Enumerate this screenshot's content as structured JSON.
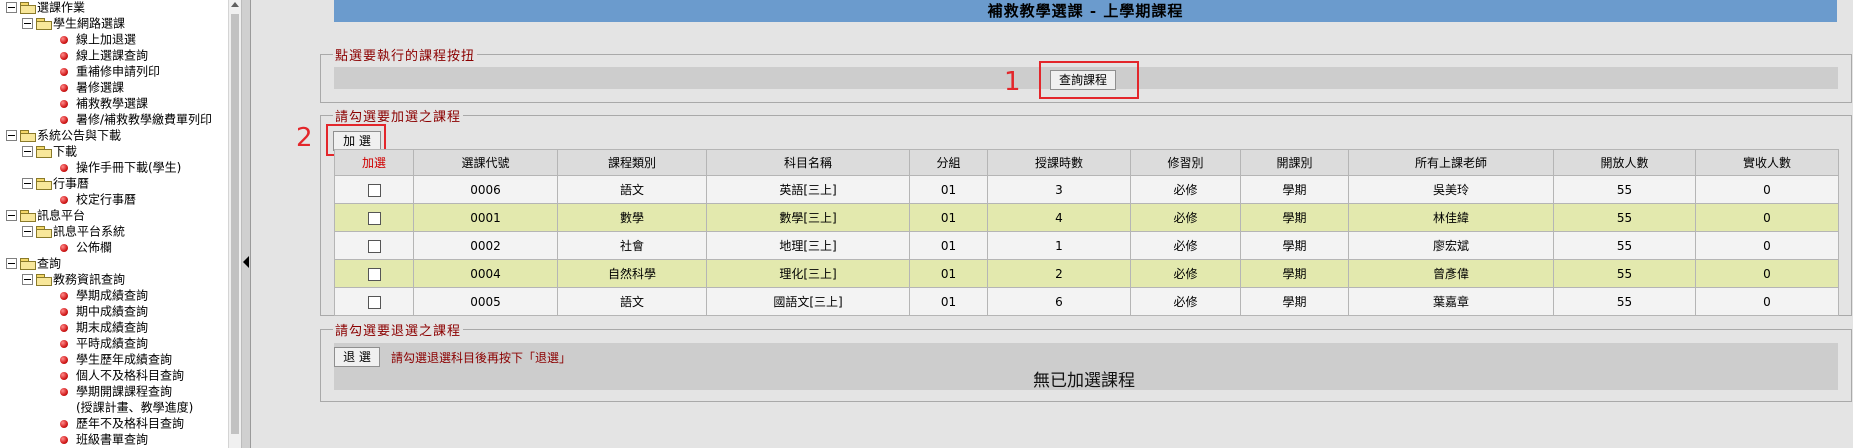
{
  "tree": {
    "items": [
      {
        "level": 0,
        "type": "folder",
        "label": "選課作業"
      },
      {
        "level": 1,
        "type": "folder",
        "label": "學生網路選課"
      },
      {
        "level": 2,
        "type": "leaf",
        "label": "線上加退選"
      },
      {
        "level": 2,
        "type": "leaf",
        "label": "線上選課查詢"
      },
      {
        "level": 2,
        "type": "leaf",
        "label": "重補修申請列印"
      },
      {
        "level": 2,
        "type": "leaf",
        "label": "暑修選課"
      },
      {
        "level": 2,
        "type": "leaf",
        "label": "補救教學選課"
      },
      {
        "level": 2,
        "type": "leaf",
        "label": "暑修/補救教學繳費單列印"
      },
      {
        "level": 0,
        "type": "folder",
        "label": "系統公告與下載"
      },
      {
        "level": 1,
        "type": "folder",
        "label": "下載"
      },
      {
        "level": 2,
        "type": "leaf",
        "label": "操作手冊下載(學生)"
      },
      {
        "level": 1,
        "type": "folder",
        "label": "行事曆"
      },
      {
        "level": 2,
        "type": "leaf",
        "label": "校定行事曆"
      },
      {
        "level": 0,
        "type": "folder",
        "label": "訊息平台"
      },
      {
        "level": 1,
        "type": "folder",
        "label": "訊息平台系統"
      },
      {
        "level": 2,
        "type": "leaf",
        "label": "公佈欄"
      },
      {
        "level": 0,
        "type": "folder",
        "label": "查詢"
      },
      {
        "level": 1,
        "type": "folder",
        "label": "教務資訊查詢"
      },
      {
        "level": 2,
        "type": "leaf",
        "label": "學期成績查詢"
      },
      {
        "level": 2,
        "type": "leaf",
        "label": "期中成績查詢"
      },
      {
        "level": 2,
        "type": "leaf",
        "label": "期末成績查詢"
      },
      {
        "level": 2,
        "type": "leaf",
        "label": "平時成績查詢"
      },
      {
        "level": 2,
        "type": "leaf",
        "label": "學生歷年成績查詢"
      },
      {
        "level": 2,
        "type": "leaf",
        "label": "個人不及格科目查詢"
      },
      {
        "level": 2,
        "type": "leaf",
        "label": "學期開課課程查詢"
      },
      {
        "level": 2,
        "type": "text",
        "label": "(授課計畫、教學進度)"
      },
      {
        "level": 2,
        "type": "leaf",
        "label": "歷年不及格科目查詢"
      },
      {
        "level": 2,
        "type": "leaf",
        "label": "班級書單查詢"
      }
    ]
  },
  "page": {
    "title": "補救教學選課 - 上學期課程"
  },
  "section1": {
    "legend": "點選要執行的課程按扭",
    "query_button": "查詢課程",
    "marker": "1"
  },
  "section2": {
    "legend": "請勾選要加選之課程",
    "add_button": "加 選",
    "marker": "2",
    "columns": [
      "加選",
      "選課代號",
      "課程類別",
      "科目名稱",
      "分組",
      "授課時數",
      "修習別",
      "開課別",
      "所有上課老師",
      "開放人數",
      "實收人數"
    ],
    "rows": [
      {
        "code": "0006",
        "category": "語文",
        "subject": "英語[三上]",
        "group": "01",
        "hours": "3",
        "type": "必修",
        "term": "學期",
        "teacher": "吳美玲",
        "open": "55",
        "enrolled": "0"
      },
      {
        "code": "0001",
        "category": "數學",
        "subject": "數學[三上]",
        "group": "01",
        "hours": "4",
        "type": "必修",
        "term": "學期",
        "teacher": "林佳緯",
        "open": "55",
        "enrolled": "0"
      },
      {
        "code": "0002",
        "category": "社會",
        "subject": "地理[三上]",
        "group": "01",
        "hours": "1",
        "type": "必修",
        "term": "學期",
        "teacher": "廖宏斌",
        "open": "55",
        "enrolled": "0"
      },
      {
        "code": "0004",
        "category": "自然科學",
        "subject": "理化[三上]",
        "group": "01",
        "hours": "2",
        "type": "必修",
        "term": "學期",
        "teacher": "曾彥偉",
        "open": "55",
        "enrolled": "0"
      },
      {
        "code": "0005",
        "category": "語文",
        "subject": "國語文[三上]",
        "group": "01",
        "hours": "6",
        "type": "必修",
        "term": "學期",
        "teacher": "葉嘉章",
        "open": "55",
        "enrolled": "0"
      }
    ]
  },
  "section3": {
    "legend": "請勾選要退選之課程",
    "drop_button": "退 選",
    "note": "請勾選退選科目後再按下「退選」",
    "empty_message": "無已加選課程"
  },
  "colors": {
    "title_bar": "#6b9bcd",
    "row_alt": "#e3e9ae",
    "legend": "#8b0000",
    "annotation": "#e3262b"
  }
}
